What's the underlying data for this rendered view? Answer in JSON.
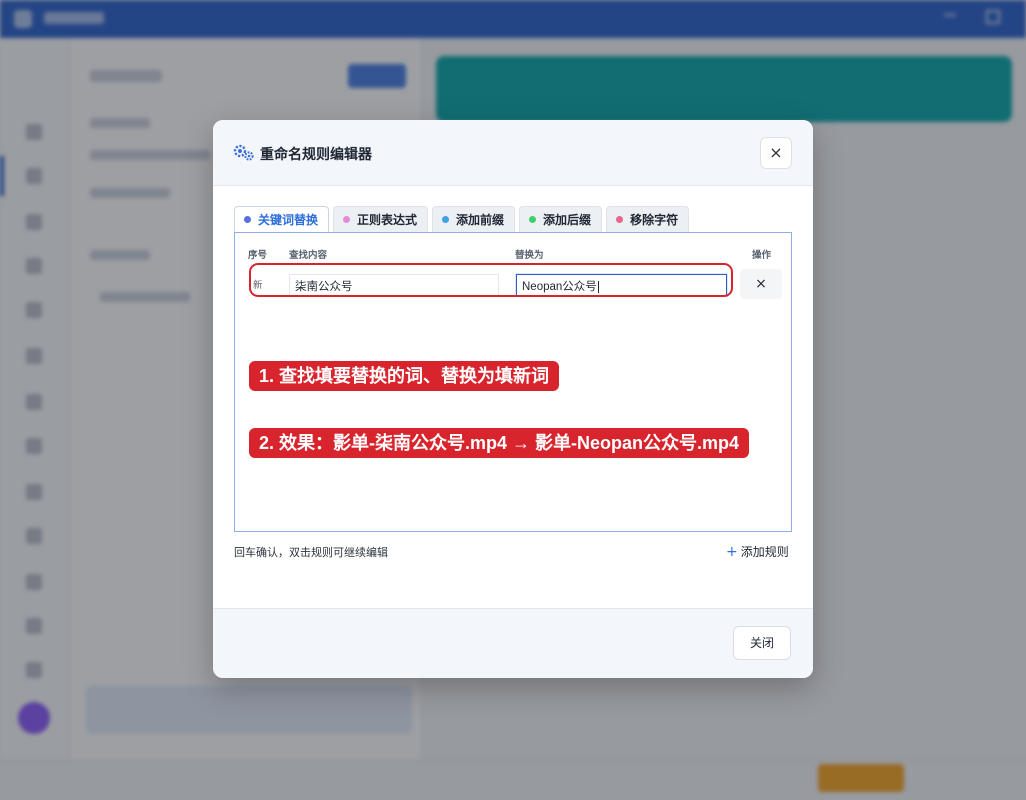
{
  "dialog": {
    "title": "重命名规则编辑器",
    "close_icon": "×",
    "tabs": [
      {
        "label": "关键词替换",
        "color": "#5a6ee0",
        "active": true
      },
      {
        "label": "正则表达式",
        "color": "#e58ad8",
        "active": false
      },
      {
        "label": "添加前缀",
        "color": "#3ea0e6",
        "active": false
      },
      {
        "label": "添加后缀",
        "color": "#3fce6a",
        "active": false
      },
      {
        "label": "移除字符",
        "color": "#e8678a",
        "active": false
      }
    ],
    "columns": {
      "index": "序号",
      "find": "查找内容",
      "replace": "替换为",
      "action": "操作"
    },
    "rule_row": {
      "index": "新",
      "find_value": "柒南公众号",
      "replace_value": "Neopan公众号",
      "delete_icon": "×"
    },
    "hint": "回车确认，双击规则可继续编辑",
    "add_rule": "添加规则",
    "add_icon": "+",
    "close_button": "关闭"
  },
  "annotations": {
    "step1": "1. 查找填要替换的词、替换为填新词",
    "step2": "2. 效果：影单-柒南公众号.mp4 → 影单-Neopan公众号.mp4"
  },
  "colors": {
    "accent": "#2f6fdc",
    "annotation_red": "#d8242c",
    "header_blue": "#2f63c8"
  }
}
